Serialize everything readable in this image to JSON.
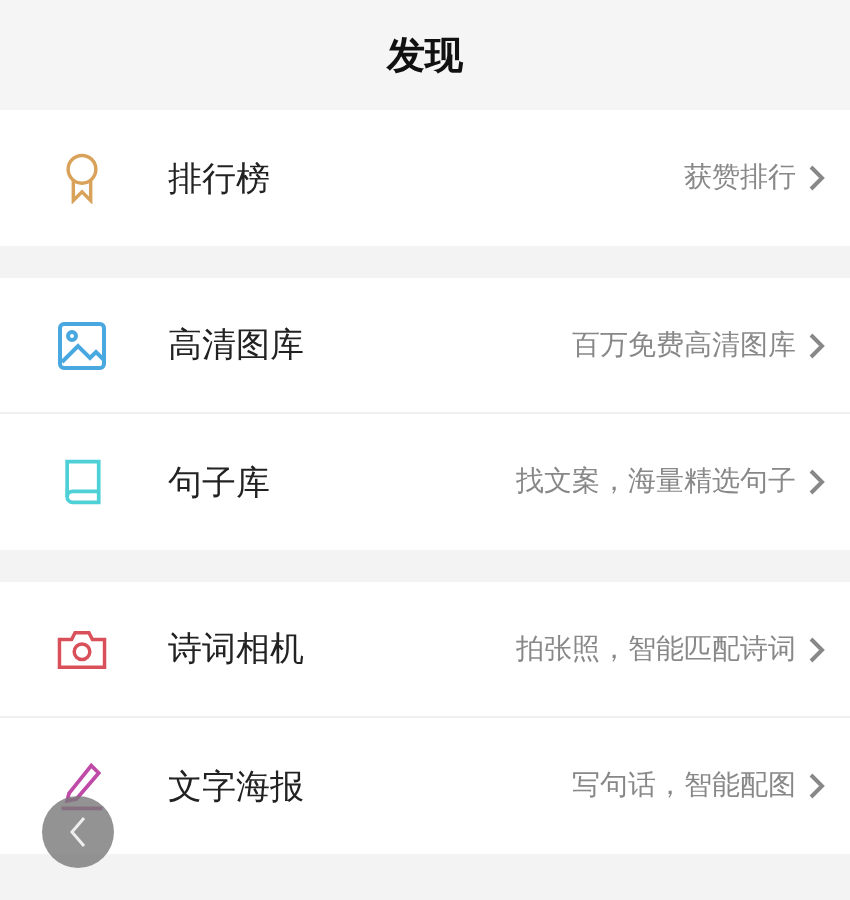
{
  "header": {
    "title": "发现"
  },
  "sections": [
    {
      "items": [
        {
          "kind": "award",
          "label": "排行榜",
          "hint": "获赞排行"
        }
      ]
    },
    {
      "items": [
        {
          "kind": "image",
          "label": "高清图库",
          "hint": "百万免费高清图库"
        },
        {
          "kind": "book",
          "label": "句子库",
          "hint": "找文案，海量精选句子"
        }
      ]
    },
    {
      "items": [
        {
          "kind": "camera",
          "label": "诗词相机",
          "hint": "拍张照，智能匹配诗词"
        },
        {
          "kind": "pen",
          "label": "文字海报",
          "hint": "写句话，智能配图"
        }
      ]
    }
  ]
}
